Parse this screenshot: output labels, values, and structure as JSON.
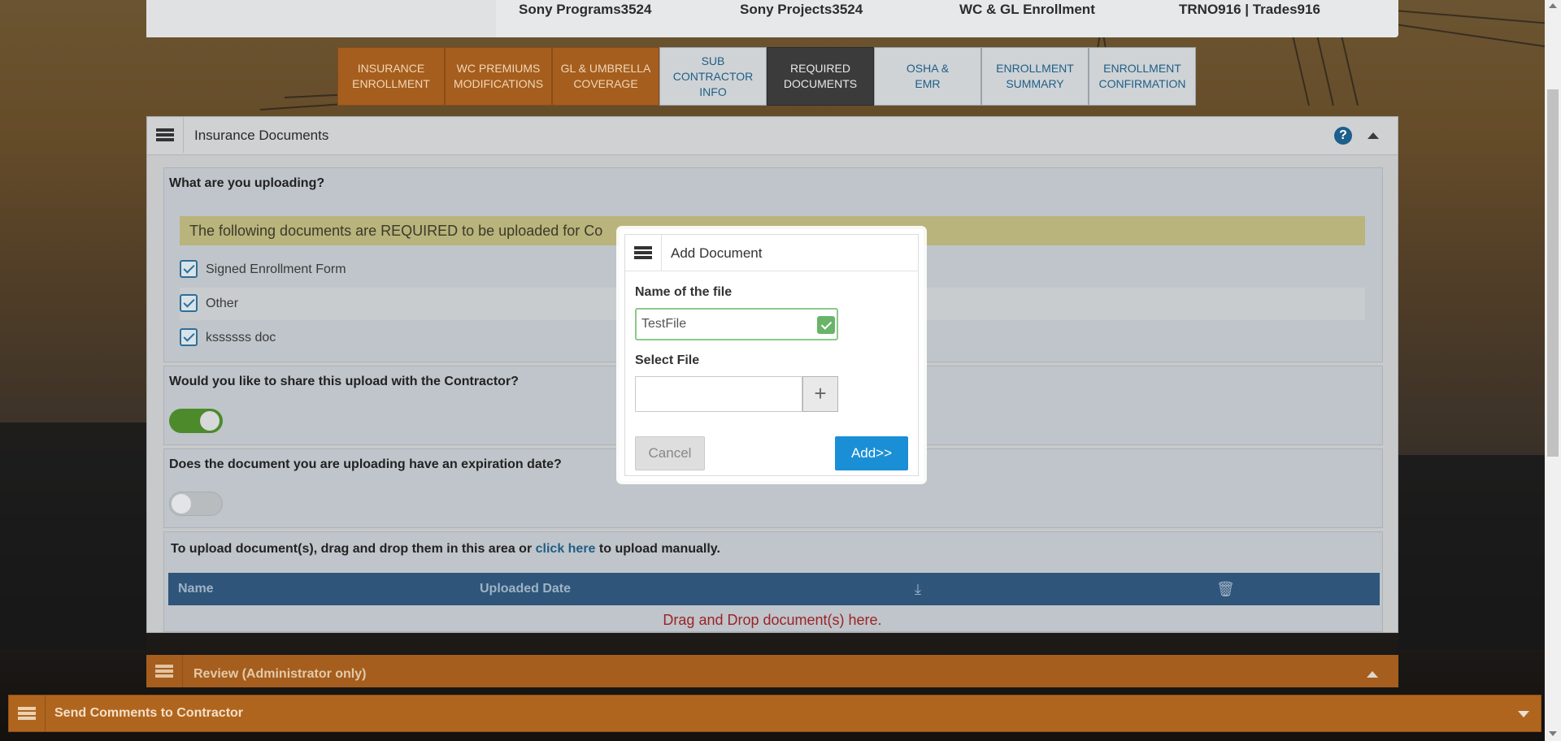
{
  "header": {
    "program": "Sony Programs3524",
    "project": "Sony Projects3524",
    "enrollment": "WC & GL Enrollment",
    "trade": "TRNO916 | Trades916"
  },
  "tabs": [
    {
      "line1": "INSURANCE",
      "line2": "ENROLLMENT",
      "state": "completed"
    },
    {
      "line1": "WC PREMIUMS",
      "line2": "MODIFICATIONS",
      "state": "completed"
    },
    {
      "line1": "GL & UMBRELLA",
      "line2": "COVERAGE",
      "state": "completed"
    },
    {
      "line1": "SUB CONTRACTOR",
      "line2": "INFO",
      "state": "pending"
    },
    {
      "line1": "REQUIRED",
      "line2": "DOCUMENTS",
      "state": "active"
    },
    {
      "line1": "OSHA &",
      "line2": "EMR",
      "state": "pending"
    },
    {
      "line1": "ENROLLMENT",
      "line2": "SUMMARY",
      "state": "pending"
    },
    {
      "line1": "ENROLLMENT",
      "line2": "CONFIRMATION",
      "state": "pending"
    }
  ],
  "panel": {
    "title": "Insurance Documents",
    "upload_question": "What are you uploading?",
    "notice": "The following documents are REQUIRED to be uploaded for Co",
    "documents": [
      {
        "label": "Signed Enrollment Form",
        "checked": true
      },
      {
        "label": "Other",
        "checked": true
      },
      {
        "label": "kssssss doc",
        "checked": true
      }
    ],
    "share_question": "Would you like to share this upload with the Contractor?",
    "share_enabled": true,
    "expiration_question": "Does the document you are uploading have an expiration date?",
    "expiration_enabled": false,
    "upload_prefix": "To upload document(s), drag and drop them in this area or ",
    "upload_link": "click here",
    "upload_suffix": " to upload manually.",
    "table_headers": {
      "name": "Name",
      "uploaded_date": "Uploaded Date"
    },
    "drop_text": "Drag and Drop document(s) here."
  },
  "review": {
    "title": "Review (Administrator only)"
  },
  "comments": {
    "title": "Send Comments to Contractor"
  },
  "modal": {
    "title": "Add Document",
    "name_label": "Name of the file",
    "name_value": "TestFile",
    "file_label": "Select File",
    "cancel_label": "Cancel",
    "add_label": "Add>>"
  },
  "colors": {
    "orange_tab": "#a55e1e",
    "active_tab": "#3b3b3b",
    "table_header": "#2f557a",
    "add_button": "#1b8fd6",
    "toggle_on": "#4c8a2c"
  }
}
